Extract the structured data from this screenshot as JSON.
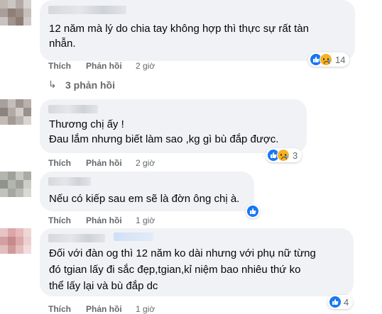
{
  "comments": [
    {
      "text_lines": [
        "12 năm mà lý do chia tay không hợp thì thực sự rất tàn",
        "nhẫn."
      ],
      "actions": {
        "like": "Thích",
        "reply": "Phản hồi",
        "time": "2 giờ"
      },
      "reactions": {
        "icons": [
          "like-icon",
          "sad-icon"
        ],
        "count": "14"
      },
      "replies_label": "3 phản hồi"
    },
    {
      "text_lines": [
        "Thương chị ấy !",
        "Đau lắm nhưng biết làm sao ,kg gì bù đắp được."
      ],
      "actions": {
        "like": "Thích",
        "reply": "Phản hồi",
        "time": "2 giờ"
      },
      "reactions": {
        "icons": [
          "like-icon",
          "sad-icon"
        ],
        "count": "3"
      }
    },
    {
      "text_lines": [
        "Nếu có kiếp sau em sẽ là đờn ông chị à."
      ],
      "actions": {
        "like": "Thích",
        "reply": "Phản hồi",
        "time": "1 giờ"
      },
      "reactions": {
        "icons": [
          "like-icon"
        ],
        "count": ""
      }
    },
    {
      "text_lines": [
        "Đối với đàn og thì 12 năm ko dài nhưng với phụ nữ từng",
        "đó tgian lấy đi sắc đẹp,tgian,kỉ niệm bao nhiêu thứ ko",
        "thể lấy lại và bù đắp dc"
      ],
      "actions": {
        "like": "Thích",
        "reply": "Phản hồi",
        "time": "1 giờ"
      },
      "reactions": {
        "icons": [
          "like-icon"
        ],
        "count": "4"
      }
    }
  ],
  "colors": {
    "bubble": "#f0f2f5",
    "meta": "#65676b",
    "like": "#1877f2",
    "sad": "#f7b125"
  }
}
